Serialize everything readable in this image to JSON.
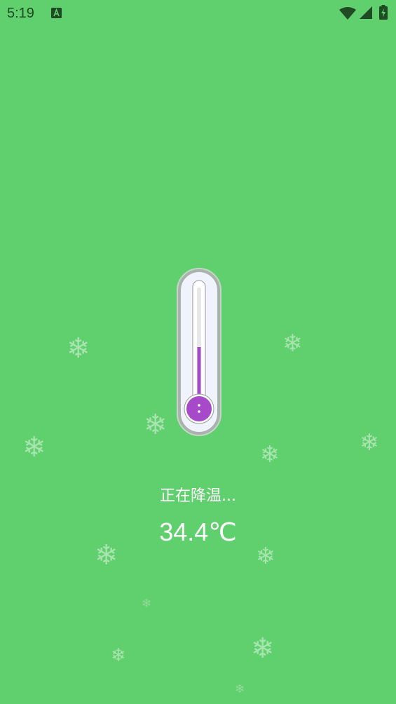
{
  "status_bar": {
    "time": "5:19",
    "icons": [
      "notification-a-icon",
      "wifi-icon",
      "cellular-signal-icon",
      "battery-charging-icon"
    ]
  },
  "main": {
    "status_text": "正在降温...",
    "temperature": "34.4℃",
    "thermometer": {
      "fill_fraction": 0.5,
      "fill_color": "#a64ac9"
    }
  },
  "colors": {
    "background": "#60cf6d",
    "text": "#ffffff",
    "accent": "#a64ac9"
  }
}
